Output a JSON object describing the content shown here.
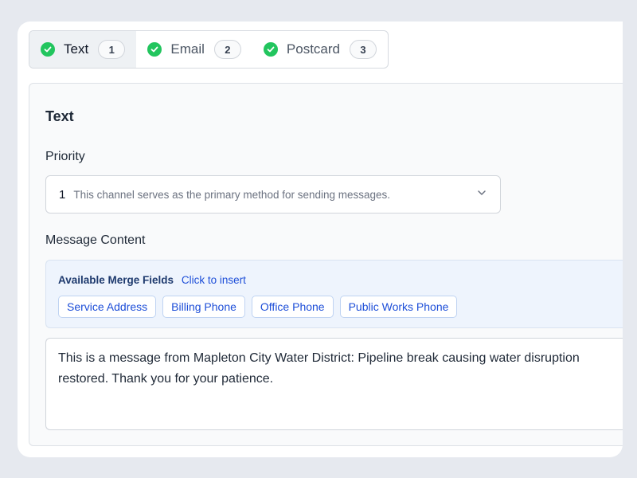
{
  "tabs": [
    {
      "label": "Text",
      "count": "1",
      "status_icon": "check-circle-icon",
      "active": true
    },
    {
      "label": "Email",
      "count": "2",
      "status_icon": "check-circle-icon",
      "active": false
    },
    {
      "label": "Postcard",
      "count": "3",
      "status_icon": "check-circle-icon",
      "active": false
    }
  ],
  "panel": {
    "title": "Text",
    "priority": {
      "label": "Priority",
      "value": "1",
      "description": "This channel serves as the primary method for sending messages.",
      "icon": "chevron-down-icon"
    },
    "message": {
      "label": "Message Content",
      "merge_fields_title": "Available Merge Fields",
      "merge_fields_hint": "Click to insert",
      "merge_fields": [
        "Service Address",
        "Billing Phone",
        "Office Phone",
        "Public Works Phone"
      ],
      "lines": [
        "This is a message from Mapleton City Water District: Pipeline break causing water disruption",
        "restored. Thank you for your patience."
      ]
    }
  },
  "colors": {
    "success": "#22c55e",
    "link": "#1d4ed8",
    "merge_bg": "#eef4fd"
  }
}
